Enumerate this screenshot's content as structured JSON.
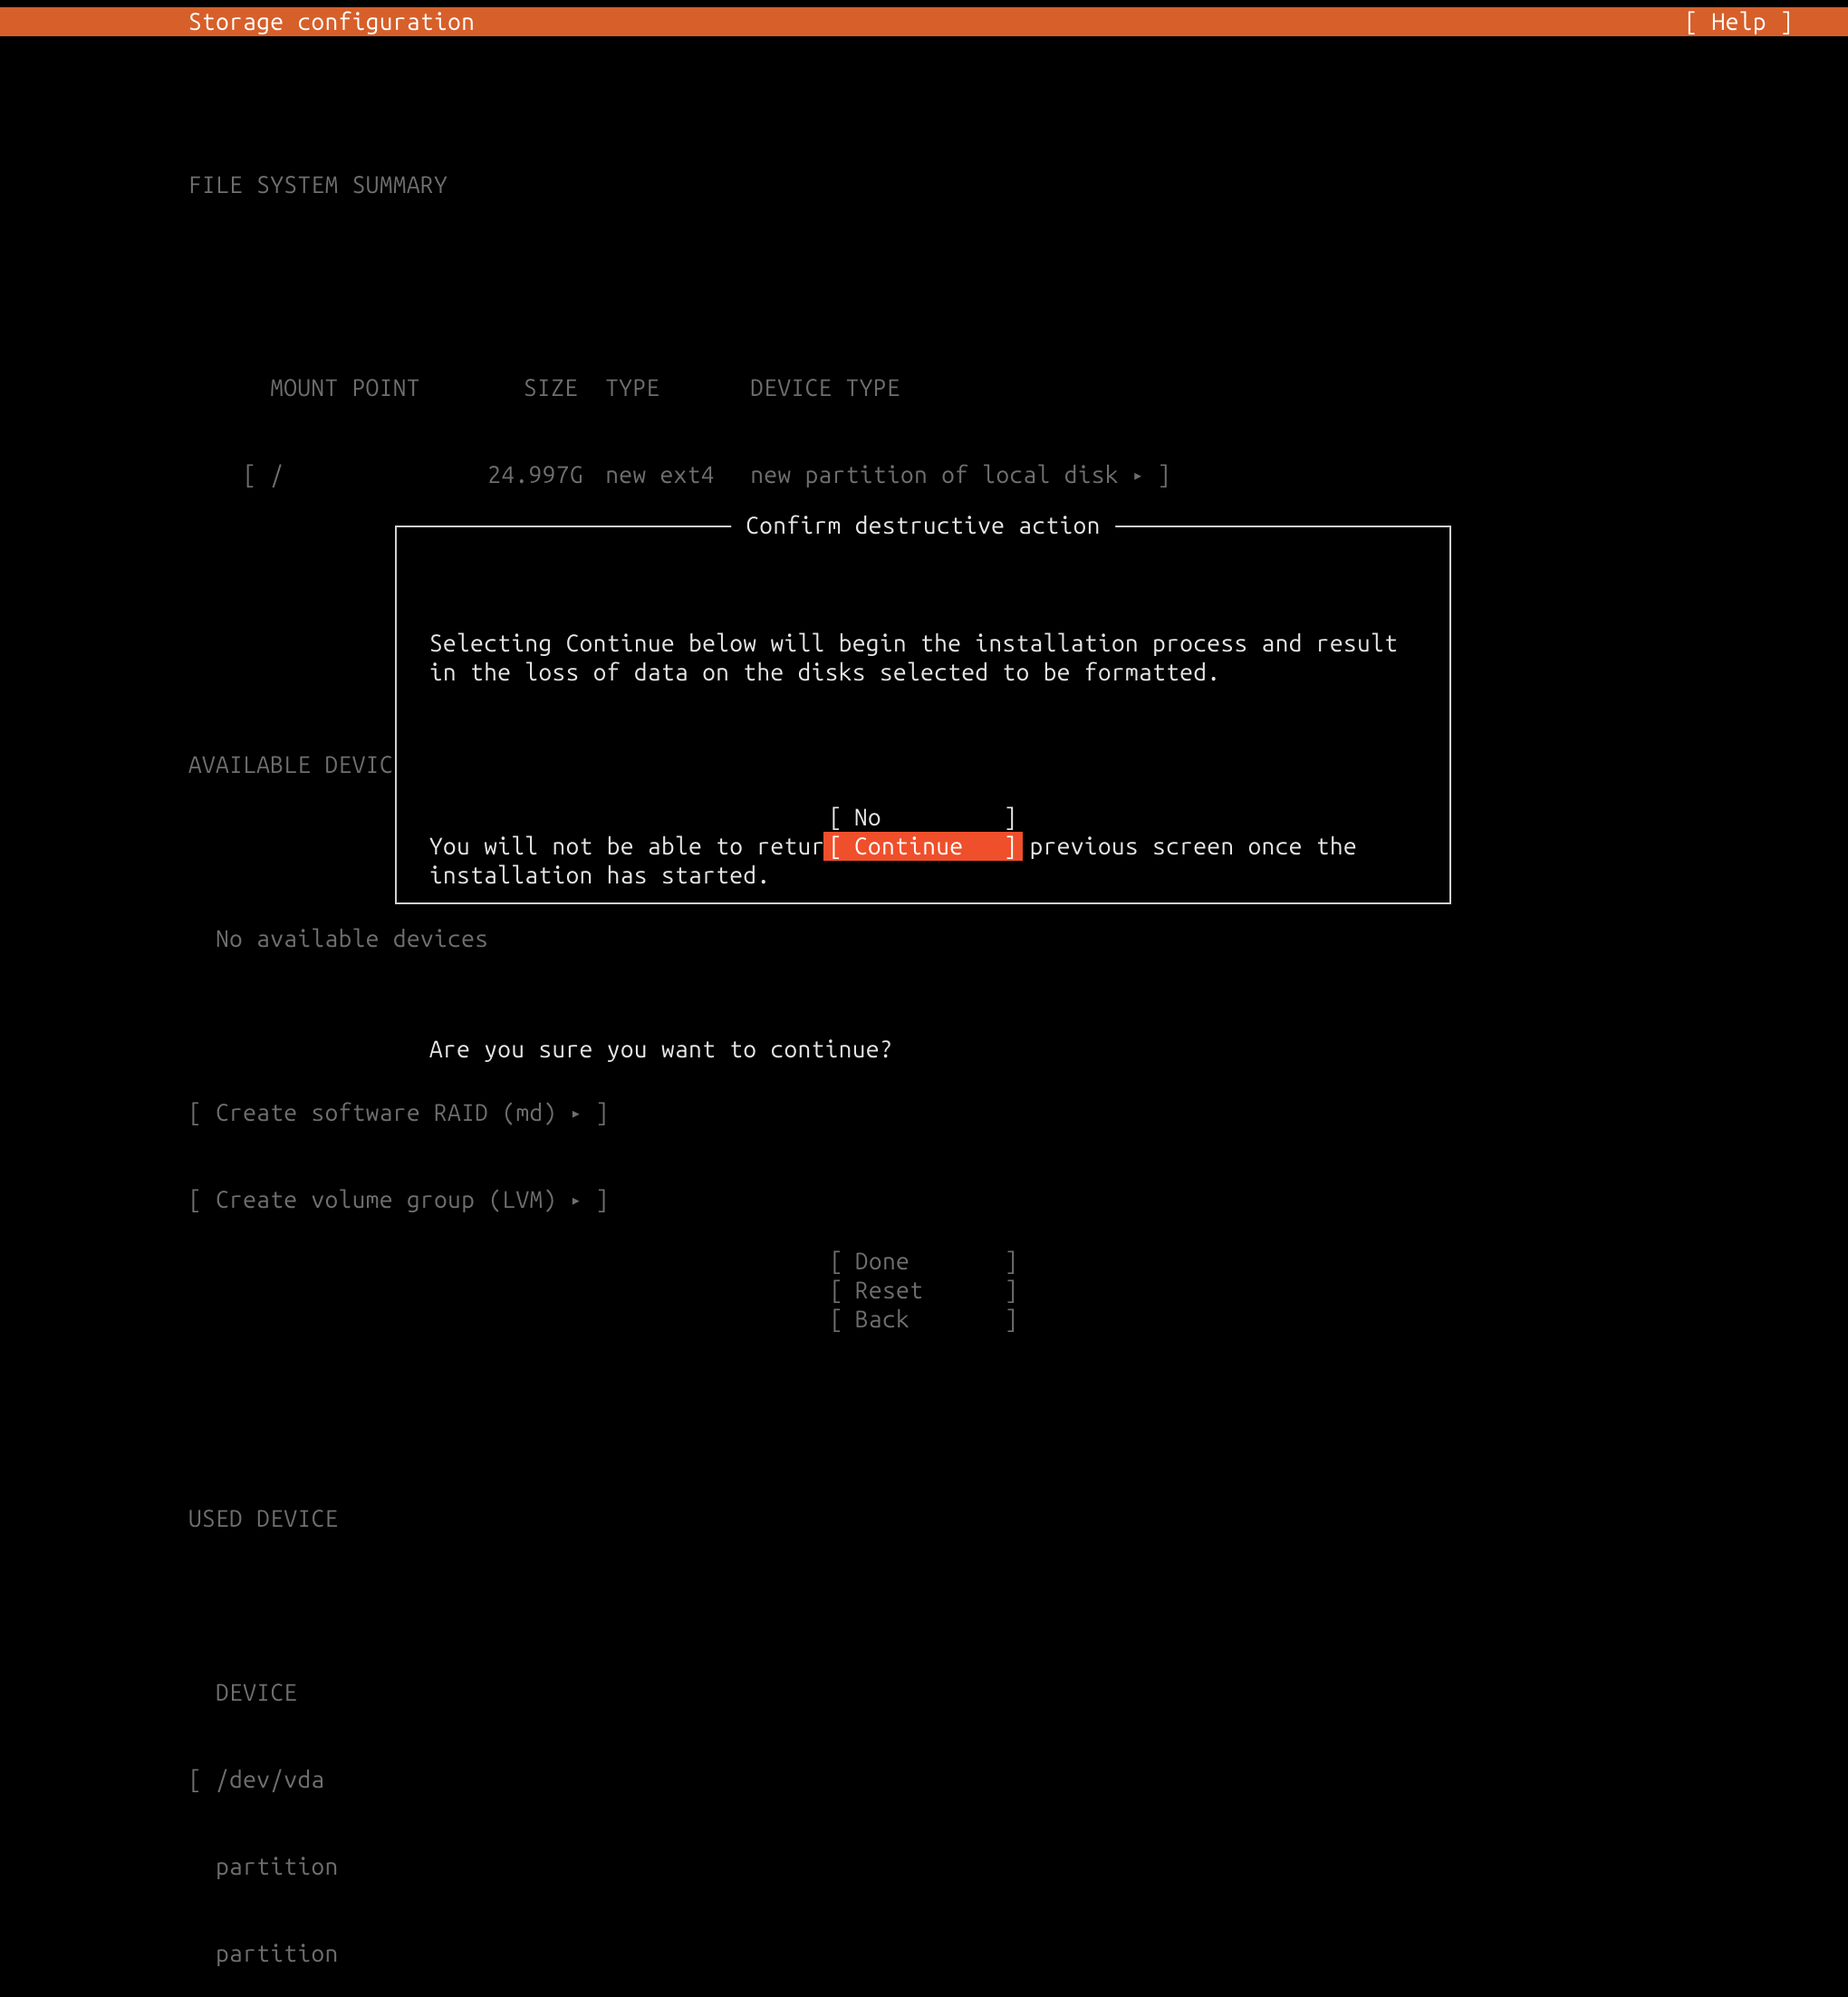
{
  "header": {
    "title": "Storage configuration",
    "help": "[ Help ]"
  },
  "fs_summary": {
    "heading": "FILE SYSTEM SUMMARY",
    "cols": {
      "mount": "MOUNT POINT",
      "size": "SIZE",
      "type": "TYPE",
      "dev": "DEVICE TYPE"
    },
    "row": {
      "mount": "/",
      "size": "24.997G",
      "type": "new ext4",
      "dev": "new partition of local disk"
    }
  },
  "available": {
    "heading": "AVAILABLE DEVICES",
    "none": "No available devices",
    "raid": "Create software RAID (md)",
    "lvm": "Create volume group (LVM)"
  },
  "used": {
    "heading": "USED DEVICE",
    "col": "DEVICE",
    "dev": "/dev/vda",
    "p1": "partition",
    "p2": "partition"
  },
  "modal": {
    "title": "Confirm destructive action",
    "p1": "Selecting Continue below will begin the installation process and result in the loss of data on the disks selected to be formatted.",
    "p2": "You will not be able to return to this or a previous screen once the installation has started.",
    "p3": "Are you sure you want to continue?",
    "no": "No",
    "cont": "Continue"
  },
  "footer": {
    "done": "Done",
    "reset": "Reset",
    "back": "Back"
  },
  "glyph": {
    "arrow": "▸",
    "lb": "[",
    "rb": "]"
  }
}
